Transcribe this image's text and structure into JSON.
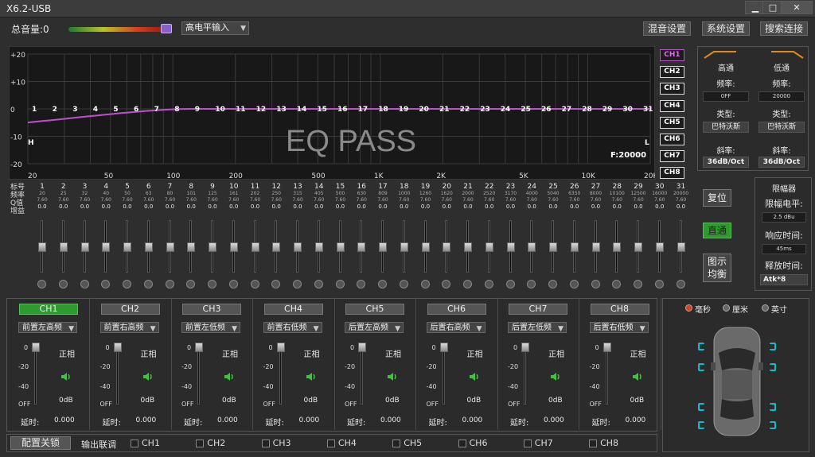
{
  "window": {
    "title": "X6.2-USB",
    "min": "▁",
    "max": "□",
    "close": "✕"
  },
  "toolbar": {
    "volume_label": "总音量:0",
    "input_mode": "高电平输入",
    "mix_settings": "混音设置",
    "system_settings": "系统设置",
    "search_connect": "搜索连接"
  },
  "graph": {
    "watermark": "EQ PASS",
    "freq_readout": "F:20000",
    "y_labels": [
      "+20",
      "+10",
      "0",
      "-10",
      "-20"
    ],
    "x_labels": [
      "20",
      "50",
      "100",
      "200",
      "500",
      "1K",
      "2K",
      "5K",
      "10K",
      "20K"
    ],
    "hp_marker": "H",
    "lp_marker": "L",
    "point_labels": [
      "1",
      "2",
      "3",
      "4",
      "5",
      "6",
      "7",
      "8",
      "9",
      "10",
      "11",
      "12",
      "13",
      "14",
      "15",
      "16",
      "17",
      "18",
      "19",
      "20",
      "21",
      "22",
      "23",
      "24",
      "25",
      "26",
      "27",
      "28",
      "29",
      "30",
      "31"
    ],
    "channels": [
      "CH1",
      "CH2",
      "CH3",
      "CH4",
      "CH5",
      "CH6",
      "CH7",
      "CH8"
    ],
    "active_channel": "CH1"
  },
  "filters": {
    "highpass": {
      "title": "高通",
      "freq_label": "频率:",
      "freq": "0FF",
      "type_label": "类型:",
      "type": "巴特沃斯",
      "slope_label": "斜率:",
      "slope": "36dB/Oct"
    },
    "lowpass": {
      "title": "低通",
      "freq_label": "频率:",
      "freq": "20000",
      "type_label": "类型:",
      "type": "巴特沃斯",
      "slope_label": "斜率:",
      "slope": "36dB/Oct"
    }
  },
  "eq_rows": {
    "index_label": "标号",
    "freq_label": "频率",
    "q_label": "Q值",
    "gain_label": "增益"
  },
  "bands": [
    {
      "n": "1",
      "f": "20",
      "q": "7.60",
      "g": "0.0"
    },
    {
      "n": "2",
      "f": "25",
      "q": "7.60",
      "g": "0.0"
    },
    {
      "n": "3",
      "f": "32",
      "q": "7.60",
      "g": "0.0"
    },
    {
      "n": "4",
      "f": "40",
      "q": "7.60",
      "g": "0.0"
    },
    {
      "n": "5",
      "f": "50",
      "q": "7.60",
      "g": "0.0"
    },
    {
      "n": "6",
      "f": "63",
      "q": "7.60",
      "g": "0.0"
    },
    {
      "n": "7",
      "f": "80",
      "q": "7.60",
      "g": "0.0"
    },
    {
      "n": "8",
      "f": "101",
      "q": "7.60",
      "g": "0.0"
    },
    {
      "n": "9",
      "f": "125",
      "q": "7.60",
      "g": "0.0"
    },
    {
      "n": "10",
      "f": "161",
      "q": "7.60",
      "g": "0.0"
    },
    {
      "n": "11",
      "f": "202",
      "q": "7.60",
      "g": "0.0"
    },
    {
      "n": "12",
      "f": "250",
      "q": "7.60",
      "g": "0.0"
    },
    {
      "n": "13",
      "f": "315",
      "q": "7.60",
      "g": "0.0"
    },
    {
      "n": "14",
      "f": "405",
      "q": "7.60",
      "g": "0.0"
    },
    {
      "n": "15",
      "f": "500",
      "q": "7.60",
      "g": "0.0"
    },
    {
      "n": "16",
      "f": "630",
      "q": "7.60",
      "g": "0.0"
    },
    {
      "n": "17",
      "f": "809",
      "q": "7.60",
      "g": "0.0"
    },
    {
      "n": "18",
      "f": "1000",
      "q": "7.60",
      "g": "0.0"
    },
    {
      "n": "19",
      "f": "1260",
      "q": "7.60",
      "g": "0.0"
    },
    {
      "n": "20",
      "f": "1620",
      "q": "7.60",
      "g": "0.0"
    },
    {
      "n": "21",
      "f": "2000",
      "q": "7.60",
      "g": "0.0"
    },
    {
      "n": "22",
      "f": "2520",
      "q": "7.60",
      "g": "0.0"
    },
    {
      "n": "23",
      "f": "3170",
      "q": "7.60",
      "g": "0.0"
    },
    {
      "n": "24",
      "f": "4000",
      "q": "7.60",
      "g": "0.0"
    },
    {
      "n": "25",
      "f": "5040",
      "q": "7.60",
      "g": "0.0"
    },
    {
      "n": "26",
      "f": "6350",
      "q": "7.60",
      "g": "0.0"
    },
    {
      "n": "27",
      "f": "8000",
      "q": "7.60",
      "g": "0.0"
    },
    {
      "n": "28",
      "f": "10100",
      "q": "7.60",
      "g": "0.0"
    },
    {
      "n": "29",
      "f": "12500",
      "q": "7.60",
      "g": "0.0"
    },
    {
      "n": "30",
      "f": "16000",
      "q": "7.60",
      "g": "0.0"
    },
    {
      "n": "31",
      "f": "20000",
      "q": "7.60",
      "g": "0.0"
    }
  ],
  "side_buttons": {
    "reset": "复位",
    "bypass": "直通",
    "graphic_eq": "图示\n均衡"
  },
  "limiter": {
    "title": "限幅器",
    "level_label": "限幅电平:",
    "level": "2.5 dBu",
    "attack_label": "响应时间:",
    "attack": "45ms",
    "release_label": "释放时间:",
    "release": "Atk*8"
  },
  "channels": [
    {
      "name": "CH1",
      "position": "前置左高频",
      "phase": "正相",
      "gain": "0dB",
      "delay_label": "延时:",
      "delay": "0.000"
    },
    {
      "name": "CH2",
      "position": "前置右高频",
      "phase": "正相",
      "gain": "0dB",
      "delay_label": "延时:",
      "delay": "0.000"
    },
    {
      "name": "CH3",
      "position": "前置左低频",
      "phase": "正相",
      "gain": "0dB",
      "delay_label": "延时:",
      "delay": "0.000"
    },
    {
      "name": "CH4",
      "position": "前置右低频",
      "phase": "正相",
      "gain": "0dB",
      "delay_label": "延时:",
      "delay": "0.000"
    },
    {
      "name": "CH5",
      "position": "后置左高频",
      "phase": "正相",
      "gain": "0dB",
      "delay_label": "延时:",
      "delay": "0.000"
    },
    {
      "name": "CH6",
      "position": "后置右高频",
      "phase": "正相",
      "gain": "0dB",
      "delay_label": "延时:",
      "delay": "0.000"
    },
    {
      "name": "CH7",
      "position": "后置左低频",
      "phase": "正相",
      "gain": "0dB",
      "delay_label": "延时:",
      "delay": "0.000"
    },
    {
      "name": "CH8",
      "position": "后置右低频",
      "phase": "正相",
      "gain": "0dB",
      "delay_label": "延时:",
      "delay": "0.000"
    }
  ],
  "fader_scale": [
    "0",
    "-20",
    "-40",
    "OFF"
  ],
  "bottom": {
    "lock": "配置关锁",
    "link_label": "输出联调",
    "link_channels": [
      "CH1",
      "CH2",
      "CH3",
      "CH4",
      "CH5",
      "CH6",
      "CH7",
      "CH8"
    ]
  },
  "units": {
    "ms": "毫秒",
    "cm": "厘米",
    "inch": "英寸",
    "selected": "毫秒"
  },
  "colors": {
    "accent": "#c04fd0",
    "active_green": "#2f9a2f",
    "speaker": "#19b8c8",
    "filter_orange": "#e08a1e"
  }
}
